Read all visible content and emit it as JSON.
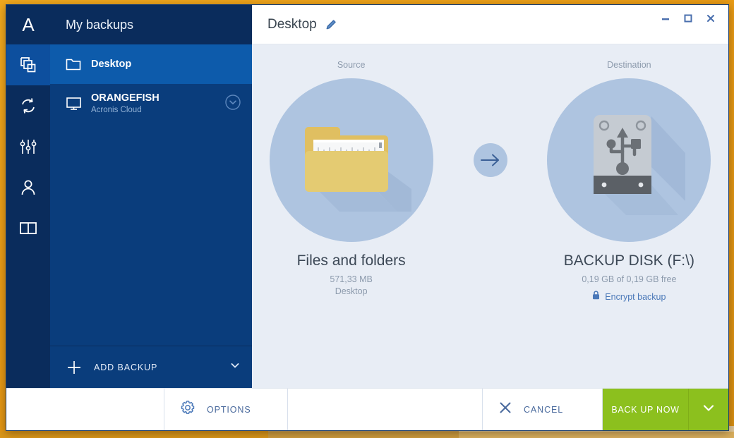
{
  "window": {
    "controls": [
      {
        "name": "minimize",
        "glyph": "minimize-icon"
      },
      {
        "name": "maximize",
        "glyph": "maximize-icon"
      },
      {
        "name": "close",
        "glyph": "close-icon"
      }
    ]
  },
  "rail": {
    "logo": "A",
    "items": [
      {
        "id": "backup",
        "icon": "backup-stack-icon",
        "active": true
      },
      {
        "id": "sync",
        "icon": "sync-refresh-icon",
        "active": false
      },
      {
        "id": "tools",
        "icon": "sliders-tools-icon",
        "active": false
      },
      {
        "id": "account",
        "icon": "person-account-icon",
        "active": false
      },
      {
        "id": "help",
        "icon": "book-help-icon",
        "active": false
      }
    ]
  },
  "sidebar": {
    "heading": "My backups",
    "backups": [
      {
        "title": "Desktop",
        "subtitle": "",
        "icon": "folder-icon",
        "selected": true,
        "has_chevron": false
      },
      {
        "title": "ORANGEFISH",
        "subtitle": "Acronis Cloud",
        "icon": "monitor-icon",
        "selected": false,
        "has_chevron": true
      }
    ],
    "add_backup": {
      "label": "ADD BACKUP",
      "plus_icon": "plus-icon",
      "chevron_icon": "chevron-down-icon"
    }
  },
  "main": {
    "title": "Desktop",
    "edit_icon": "pencil-edit-icon",
    "source": {
      "caption": "Source",
      "icon": "folder-documents-icon",
      "name": "Files and folders",
      "size": "571,33 MB",
      "location": "Desktop"
    },
    "arrow_icon": "arrow-right-icon",
    "destination": {
      "caption": "Destination",
      "icon": "usb-external-drive-icon",
      "name": "BACKUP DISK (F:\\)",
      "capacity": "0,19 GB of 0,19 GB free",
      "encrypt_label": "Encrypt backup",
      "lock_icon": "lock-icon"
    }
  },
  "bottom_bar": {
    "options": {
      "label": "OPTIONS",
      "icon": "gear-icon"
    },
    "cancel": {
      "label": "CANCEL",
      "icon": "close-x-icon"
    },
    "backup_now": {
      "label": "BACK UP NOW",
      "chevron_icon": "chevron-down-icon"
    }
  },
  "colors": {
    "rail": "#0a2c5c",
    "sidebar": "#0a3d7c",
    "selected_row": "#0d5bab",
    "accent_green": "#8cc01e",
    "link_blue": "#4a78b8",
    "disc_blue": "#aec4e0",
    "canvas": "#e8edf5",
    "desktop_orange": "#f0a81e"
  }
}
